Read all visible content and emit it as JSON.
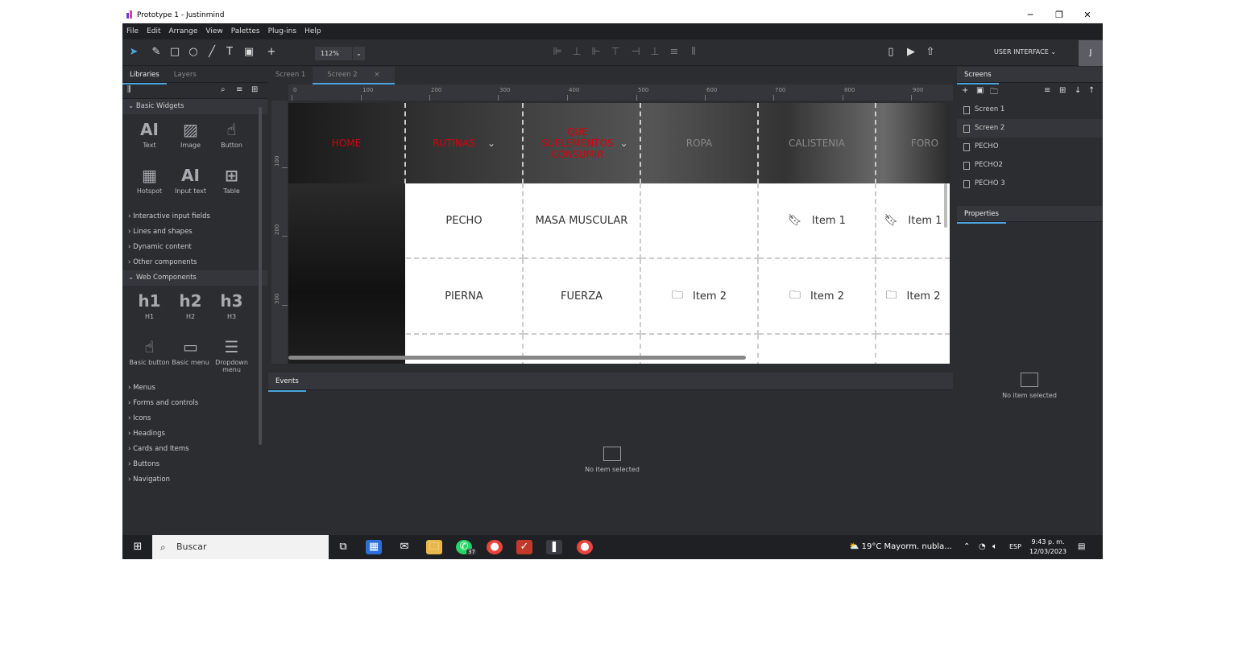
{
  "window": {
    "title": "Prototype 1 - Justinmind",
    "min": "─",
    "max": "❐",
    "close": "✕"
  },
  "menu": [
    "File",
    "Edit",
    "Arrange",
    "View",
    "Palettes",
    "Plug-ins",
    "Help"
  ],
  "toolbar": {
    "zoom": "112%",
    "ui_label": "USER INTERFACE",
    "avatar": "J"
  },
  "left": {
    "tabs": [
      "Libraries",
      "Layers"
    ],
    "basic_widgets": "Basic Widgets",
    "widgets": [
      {
        "label": "Text",
        "icon": "AI"
      },
      {
        "label": "Image",
        "icon": "▨"
      },
      {
        "label": "Button",
        "icon": "☝"
      },
      {
        "label": "Hotspot",
        "icon": "▦"
      },
      {
        "label": "Input text",
        "icon": "AI"
      },
      {
        "label": "Table",
        "icon": "⊞"
      }
    ],
    "sections1": [
      "Interactive input fields",
      "Lines and shapes",
      "Dynamic content",
      "Other components"
    ],
    "web_components": "Web Components",
    "web": [
      {
        "label": "H1",
        "icon": "h1"
      },
      {
        "label": "H2",
        "icon": "h2"
      },
      {
        "label": "H3",
        "icon": "h3"
      },
      {
        "label": "Basic button",
        "icon": "☝"
      },
      {
        "label": "Basic menu",
        "icon": "▭"
      },
      {
        "label": "Dropdown menu",
        "icon": "☰"
      }
    ],
    "sections2": [
      "Menus",
      "Forms and controls",
      "Icons",
      "Headings",
      "Cards and Items",
      "Buttons",
      "Navigation"
    ]
  },
  "center": {
    "tabs": [
      "Screen 1",
      "Screen 2"
    ],
    "ruler_h": [
      "0",
      "100",
      "200",
      "300",
      "400",
      "500",
      "600",
      "700",
      "800",
      "900"
    ],
    "ruler_v": [
      "100",
      "200",
      "300"
    ]
  },
  "canvas": {
    "nav": [
      "HOME",
      "RUTINAS",
      "QUE SUPLEMENTOS CONSUMIR",
      "ROPA",
      "CALISTENIA",
      "FORO"
    ],
    "row1": [
      "PECHO",
      "MASA MUSCULAR",
      "",
      "Item 1",
      "Item 1"
    ],
    "row2": [
      "PIERNA",
      "FUERZA",
      "Item 2",
      "Item 2",
      "Item 2"
    ]
  },
  "events": {
    "tab": "Events",
    "empty": "No item selected"
  },
  "right": {
    "screens_tab": "Screens",
    "screens": [
      "Screen 1",
      "Screen 2",
      "PECHO",
      "PECHO2",
      "PECHO 3"
    ],
    "properties_tab": "Properties",
    "empty": "No item selected"
  },
  "taskbar": {
    "search": "Buscar",
    "weather": "19°C  Mayorm. nubla...",
    "lang": "ESP",
    "time": "9:43 p. m.",
    "date": "12/03/2023",
    "badge": "37"
  }
}
